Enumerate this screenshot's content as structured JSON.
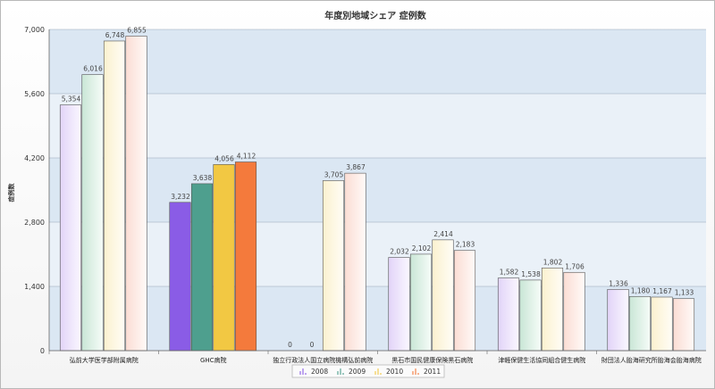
{
  "chart_data": {
    "type": "bar",
    "title": "年度別地域シェア 症例数",
    "ylabel": "症例数",
    "xlabel": "",
    "ylim": [
      0,
      7000
    ],
    "yticks": [
      "0",
      "1,400",
      "2,800",
      "4,200",
      "5,600",
      "7,000"
    ],
    "ytick_values": [
      0,
      1400,
      2800,
      4200,
      5600,
      7000
    ],
    "grid": true,
    "legend_position": "bottom",
    "categories": [
      "弘前大学医学部附属病院",
      "GHC病院",
      "独立行政法人国立病院機構弘前病院",
      "黒石市国民健康保険黒石病院",
      "津軽保健生活協同組合健生病院",
      "財団法人胎海研究所胎海会胎海病院"
    ],
    "series": [
      {
        "name": "2008",
        "values": [
          5354,
          3232,
          0,
          2032,
          1582,
          1336
        ],
        "labels": [
          "5,354",
          "3,232",
          "0",
          "2,032",
          "1,582",
          "1,336"
        ]
      },
      {
        "name": "2009",
        "values": [
          6016,
          3638,
          0,
          2102,
          1538,
          1180
        ],
        "labels": [
          "6,016",
          "3,638",
          "0",
          "2,102",
          "1,538",
          "1,180"
        ]
      },
      {
        "name": "2010",
        "values": [
          6748,
          4056,
          3705,
          2414,
          1802,
          1167
        ],
        "labels": [
          "6,748",
          "4,056",
          "3,705",
          "2,414",
          "1,802",
          "1,167"
        ]
      },
      {
        "name": "2011",
        "values": [
          6855,
          4112,
          3867,
          2183,
          1706,
          1133
        ],
        "labels": [
          "6,855",
          "4,112",
          "3,867",
          "2,183",
          "1,706",
          "1,133"
        ]
      }
    ],
    "colors": {
      "faded": [
        [
          "#e2d4f8",
          "#faf7ff"
        ],
        [
          "#c9e6d6",
          "#f6fcf8"
        ],
        [
          "#fbf1cf",
          "#fffdf6"
        ],
        [
          "#fbddd4",
          "#fffaf8"
        ]
      ],
      "solid": [
        "#8a5ce6",
        "#4e9f8e",
        "#f2c843",
        "#f47a3c"
      ],
      "plot_stripes": [
        "#dbe7f3",
        "#eaf1f8"
      ],
      "highlight_category_index": 1
    }
  }
}
